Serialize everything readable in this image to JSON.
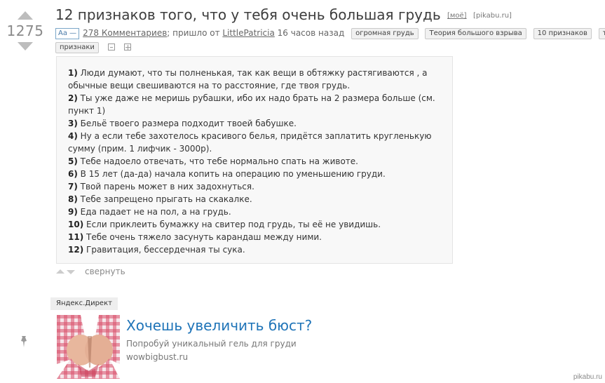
{
  "post": {
    "rating": "1275",
    "title": "12 признаков того, что у тебя очень большая грудь",
    "moe_label": "[моё]",
    "source_label": "[pikabu.ru]",
    "font_toggle": "Aa —",
    "comments_label": "278 Комментариев",
    "posted_from": "; пришло от ",
    "author": "LittlePatricia",
    "time_ago": " 16 часов назад",
    "tags": [
      "огромная грудь",
      "Теория большого взрыва",
      "10 признаков",
      "текст",
      "признаки"
    ],
    "lines": [
      {
        "num": "1)",
        "text": " Люди думают, что ты полненькая, так как вещи в обтяжку растягиваются , а обычные вещи свешиваются на то расстояние, где твоя грудь."
      },
      {
        "num": "2)",
        "text": " Ты уже даже не меришь рубашки, ибо их надо брать на 2 размера больше (см. пункт 1)"
      },
      {
        "num": "3)",
        "text": " Бельё твоего размера подходит твоей бабушке."
      },
      {
        "num": "4)",
        "text": " Ну а если тебе захотелось красивого белья, придётся заплатить кругленькую сумму (прим. 1 лифчик - 3000р)."
      },
      {
        "num": "5)",
        "text": " Тебе надоело отвечать, что тебе нормально спать на животе."
      },
      {
        "num": "6)",
        "text": " В 15 лет (да-да) начала копить на операцию по уменьшению груди."
      },
      {
        "num": "7)",
        "text": " Твой парень может в них задохнуться."
      },
      {
        "num": "8)",
        "text": " Тебе запрещено прыгать на скакалке."
      },
      {
        "num": "9)",
        "text": " Еда падает не на пол, а на грудь."
      },
      {
        "num": "10)",
        "text": " Если приклеить бумажку на свитер под грудь, ты её не увидишь."
      },
      {
        "num": "11)",
        "text": " Тебе очень тяжело засунуть карандаш между ними."
      },
      {
        "num": "12)",
        "text": " Гравитация, бессердечная ты сука."
      }
    ],
    "collapse_label": "свернуть"
  },
  "ad": {
    "label": "Яндекс.Директ",
    "title": "Хочешь увеличить бюст?",
    "description": "Попробуй уникальный гель для груди",
    "url": "wowbigbust.ru"
  },
  "watermark": "pikabu.ru",
  "colors": {
    "link_blue": "#1f74b8",
    "arrow_grey": "#bdbdbd",
    "content_bg": "#f8f8f8"
  }
}
